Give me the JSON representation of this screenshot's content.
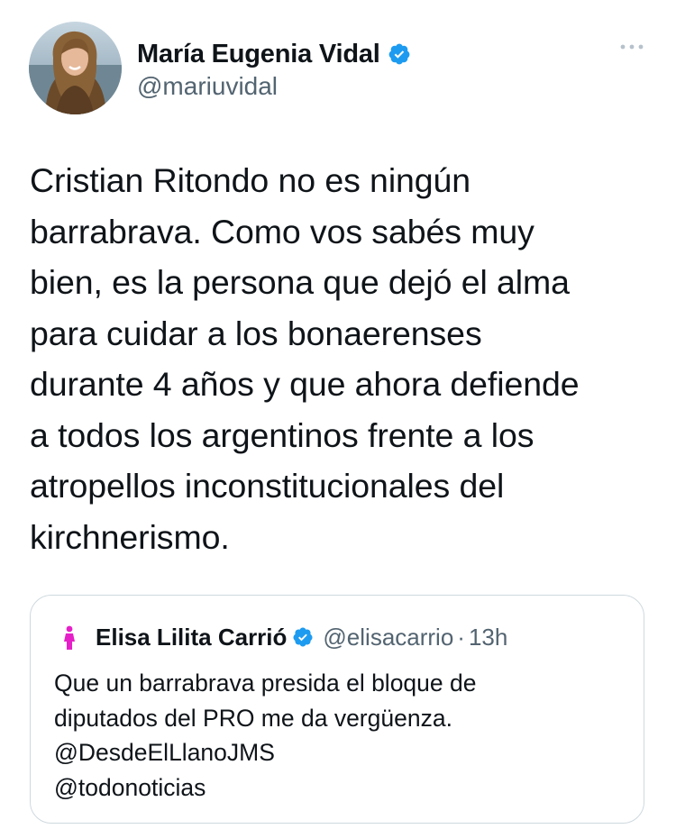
{
  "author": {
    "display_name": "María Eugenia Vidal",
    "handle": "@mariuvidal",
    "verified": true
  },
  "tweet": {
    "text": "Cristian Ritondo no es ningún\nbarrabrava. Como vos sabés muy\nbien, es la persona que dejó el alma\npara cuidar a los bonaerenses\ndurante 4 años y que ahora defiende\na todos los argentinos frente a los\natropellos inconstitucionales del\nkirchnerismo."
  },
  "quoted_tweet": {
    "display_name": "Elisa Lilita Carrió",
    "handle": "@elisacarrio",
    "separator": "·",
    "time": "13h",
    "verified": true,
    "text": "Que un barrabrava presida el bloque de\ndiputados del PRO me da vergüenza.\n@DesdeElLlanoJMS\n@todonoticias"
  },
  "icons": {
    "verified": "verified-badge-icon",
    "more": "more-options-icon"
  },
  "colors": {
    "verified_blue": "#1d9bf0",
    "text_primary": "#0f1419",
    "text_secondary": "#536471",
    "card_border": "#cfd9de",
    "quote_avatar_figure": "#e620c8"
  }
}
